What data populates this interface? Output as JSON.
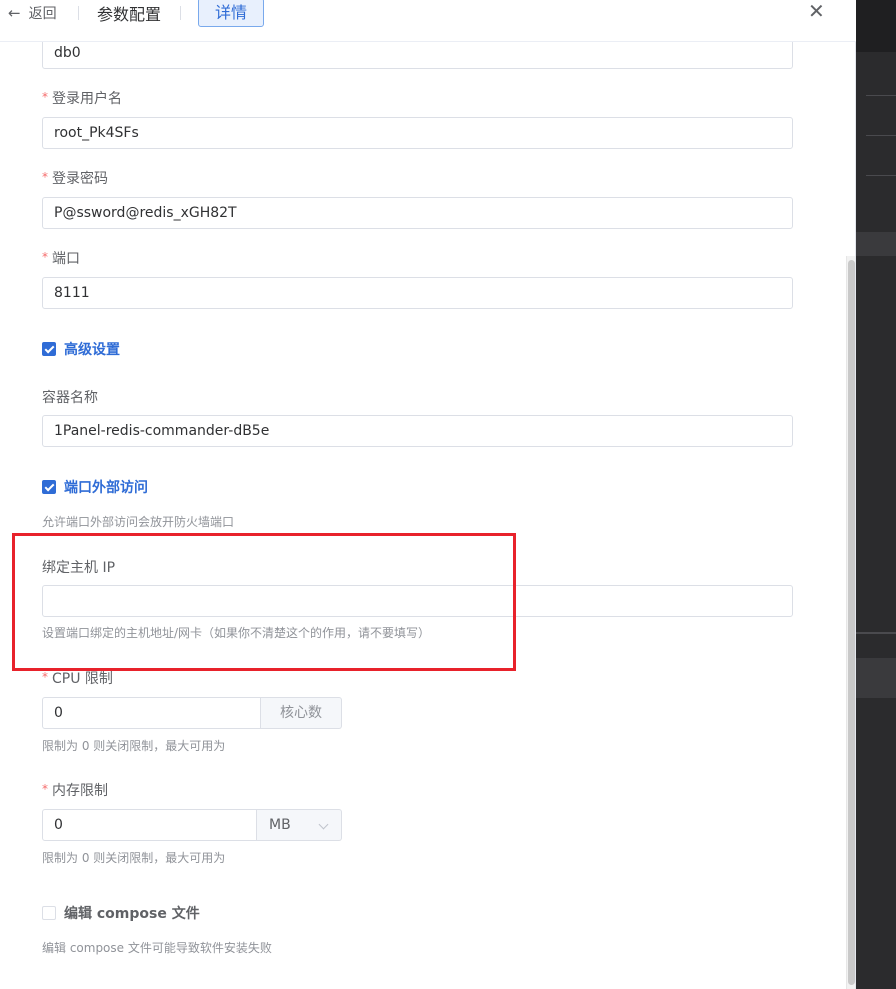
{
  "header": {
    "back_label": "返回",
    "title": "参数配置",
    "active_tab": "详情",
    "close_icon": "close-icon"
  },
  "form": {
    "database": {
      "value": "db0"
    },
    "login_user": {
      "label": "登录用户名",
      "required": true,
      "value": "root_Pk4SFs"
    },
    "login_password": {
      "label": "登录密码",
      "required": true,
      "value": "P@ssword@redis_xGH82T"
    },
    "port": {
      "label": "端口",
      "required": true,
      "value": "8111"
    },
    "advanced": {
      "label": "高级设置",
      "checked": true
    },
    "container_name": {
      "label": "容器名称",
      "value": "1Panel-redis-commander-dB5e"
    },
    "external_access": {
      "label": "端口外部访问",
      "checked": true,
      "hint": "允许端口外部访问会放开防火墙端口"
    },
    "bind_host_ip": {
      "label": "绑定主机 IP",
      "value": "",
      "hint": "设置端口绑定的主机地址/网卡（如果你不清楚这个的作用，请不要填写）"
    },
    "cpu_limit": {
      "label": "CPU 限制",
      "required": true,
      "value": "0",
      "unit": "核心数",
      "hint": "限制为 0 则关闭限制，最大可用为"
    },
    "memory_limit": {
      "label": "内存限制",
      "required": true,
      "value": "0",
      "unit": "MB",
      "hint": "限制为 0 则关闭限制，最大可用为"
    },
    "edit_compose": {
      "label": "编辑 compose 文件",
      "checked": false,
      "hint": "编辑 compose 文件可能导致软件安装失败"
    }
  },
  "colors": {
    "accent": "#2f6cd6",
    "required": "#f56c6c",
    "highlight_box": "#e8222b"
  }
}
